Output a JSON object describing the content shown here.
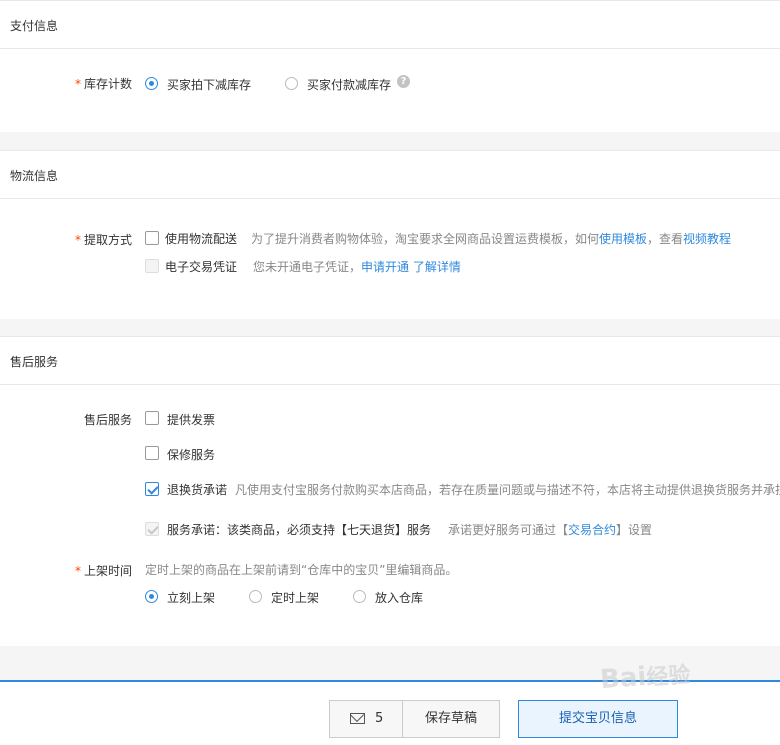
{
  "payment": {
    "title": "支付信息",
    "inventory_label": "库存计数",
    "options": [
      "买家拍下减库存",
      "买家付款减库存"
    ],
    "selected": 0,
    "help_icon": "question-circle-icon"
  },
  "logistics": {
    "title": "物流信息",
    "method_label": "提取方式",
    "use_logistics": "使用物流配送",
    "logistics_hint_prefix": "为了提升消费者购物体验，淘宝要求全网商品设置运费模板，如何",
    "logistics_hint_link1": "使用模板",
    "logistics_hint_mid": "，查看",
    "logistics_hint_link2": "视频教程",
    "e_voucher": "电子交易凭证",
    "e_voucher_hint": "您未开通电子凭证，",
    "e_voucher_link1": "申请开通",
    "e_voucher_link2": "了解详情"
  },
  "after_sales": {
    "title": "售后服务",
    "label": "售后服务",
    "invoice": "提供发票",
    "warranty": "保修服务",
    "return_promise": "退换货承诺",
    "return_hint": "凡使用支付宝服务付款购买本店商品，若存在质量问题或与描述不符，本店将主动提供退换货服务并承担",
    "service_promise": "服务承诺：该类商品，必须支持【七天退货】服务",
    "service_hint_prefix": "承诺更好服务可通过【",
    "service_hint_link": "交易合约",
    "service_hint_suffix": "】设置",
    "listing_label": "上架时间",
    "listing_hint": "定时上架的商品在上架前请到“仓库中的宝贝”里编辑商品。",
    "listing_options": [
      "立刻上架",
      "定时上架",
      "放入仓库"
    ],
    "listing_selected": 0
  },
  "footer": {
    "draft_count": "5",
    "save_draft": "保存草稿",
    "submit": "提交宝贝信息",
    "mail_icon": "envelope-icon"
  },
  "watermark": "Bai经验",
  "colors": {
    "accent": "#3089dc",
    "required_star": "#ff4400"
  }
}
